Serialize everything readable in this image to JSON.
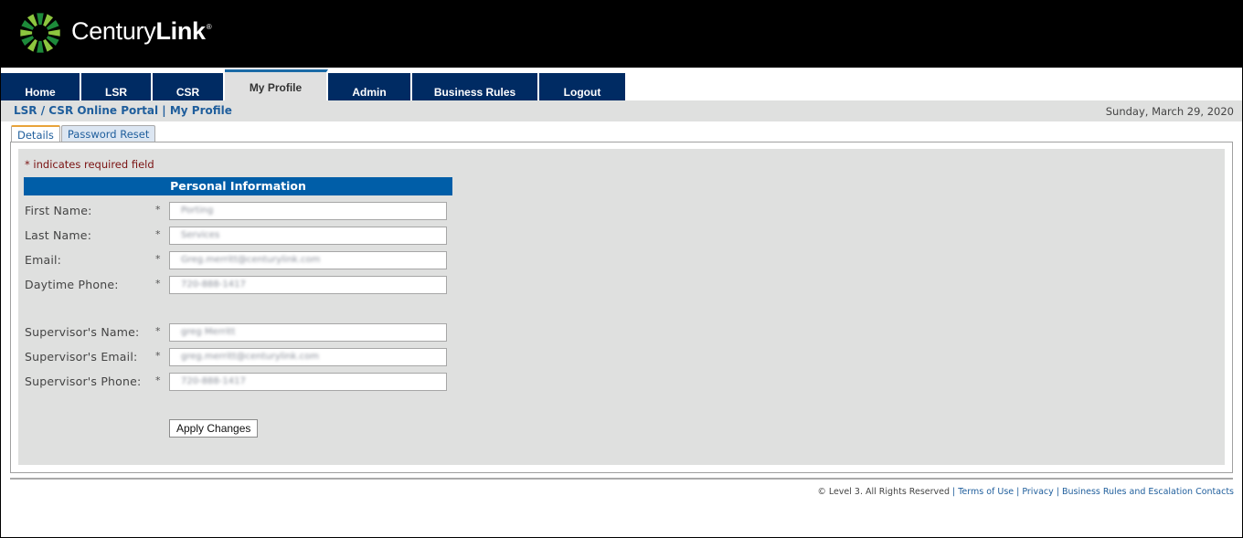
{
  "brand": {
    "name_regular": "Century",
    "name_bold": "Link",
    "registered": "®",
    "colors": {
      "green_dark": "#1d8a3a",
      "green_light": "#8dc63f",
      "nav_blue": "#002b63",
      "section_blue": "#005ea8",
      "link_blue": "#1f5e9c",
      "tab_accent": "#e8a33a"
    }
  },
  "nav": {
    "tabs": [
      {
        "label": "Home",
        "active": false
      },
      {
        "label": "LSR",
        "active": false
      },
      {
        "label": "CSR",
        "active": false
      },
      {
        "label": "My Profile",
        "active": true
      },
      {
        "label": "Admin",
        "active": false
      },
      {
        "label": "Business Rules",
        "active": false
      },
      {
        "label": "Logout",
        "active": false
      }
    ]
  },
  "breadcrumb": {
    "text": "LSR / CSR Online Portal | My Profile"
  },
  "date": "Sunday, March 29, 2020",
  "subtabs": [
    {
      "label": "Details",
      "active": true
    },
    {
      "label": "Password Reset",
      "active": false
    }
  ],
  "form": {
    "required_note": "* indicates required field",
    "section_title": "Personal Information",
    "required_marker": "*",
    "fields": [
      {
        "label": "First Name:",
        "value": "Porting"
      },
      {
        "label": "Last Name:",
        "value": "Services"
      },
      {
        "label": "Email:",
        "value": "Greg.merritt@centurylink.com"
      },
      {
        "label": "Daytime Phone:",
        "value": "720-888-1417"
      },
      {
        "label": "Supervisor's Name:",
        "value": "greg Merritt"
      },
      {
        "label": "Supervisor's Email:",
        "value": "greg.merritt@centurylink.com"
      },
      {
        "label": "Supervisor's Phone:",
        "value": "720-888-1417"
      }
    ],
    "apply_label": "Apply Changes"
  },
  "footer": {
    "copyright": "© Level 3. All Rights Reserved",
    "links": [
      "Terms of Use",
      "Privacy",
      "Business Rules and Escalation Contacts"
    ]
  }
}
